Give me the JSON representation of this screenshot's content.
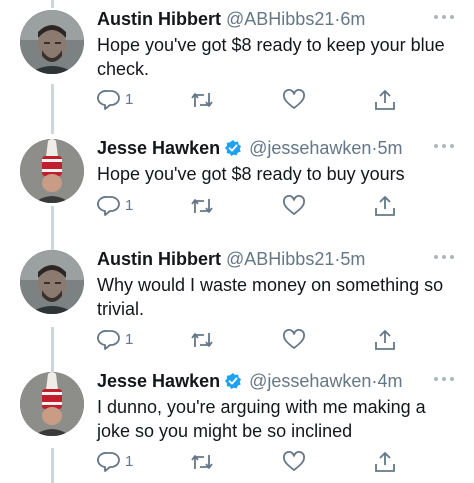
{
  "tweets": [
    {
      "author": "austin",
      "name": "Austin Hibbert",
      "handle": "@ABHibbs21",
      "separator": "·",
      "time": "6m",
      "verified": false,
      "text": "Hope you've got $8 ready to keep your blue check.",
      "reply_count": "1"
    },
    {
      "author": "jesse",
      "name": "Jesse Hawken",
      "handle": "@jessehawken",
      "separator": "·",
      "time": "5m",
      "verified": true,
      "text": "Hope you've got $8 ready to buy yours",
      "reply_count": "1"
    },
    {
      "author": "austin",
      "name": "Austin Hibbert",
      "handle": "@ABHibbs21",
      "separator": "·",
      "time": "5m",
      "verified": false,
      "text": "Why would I waste money on something so trivial.",
      "reply_count": "1"
    },
    {
      "author": "jesse",
      "name": "Jesse Hawken",
      "handle": "@jessehawken",
      "separator": "·",
      "time": "4m",
      "verified": true,
      "text": "I dunno, you're arguing with me making a joke so you might be so inclined",
      "reply_count": "1"
    }
  ],
  "icons": {
    "reply": "reply-icon",
    "retweet": "retweet-icon",
    "like": "like-icon",
    "share": "share-icon",
    "more": "more-icon",
    "verified": "verified-badge-icon"
  },
  "colors": {
    "text": "#14171a",
    "secondary": "#657786",
    "verified": "#1da1f2",
    "thread_line": "#ccd6dd"
  }
}
